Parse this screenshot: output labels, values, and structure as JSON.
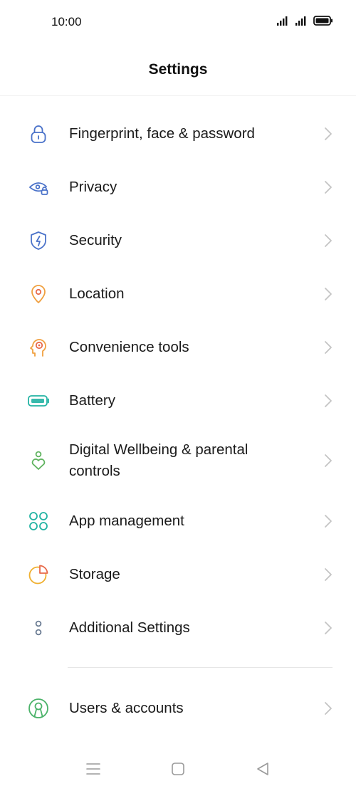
{
  "status_bar": {
    "time": "10:00",
    "icons": [
      "signal-icon",
      "signal-icon",
      "battery-icon"
    ]
  },
  "header": {
    "title": "Settings"
  },
  "settings": {
    "items": [
      {
        "label": "Fingerprint, face & password",
        "icon": "lock-icon",
        "color": "#4a72c9"
      },
      {
        "label": "Privacy",
        "icon": "privacy-eye-icon",
        "color": "#4a72c9"
      },
      {
        "label": "Security",
        "icon": "shield-icon",
        "color": "#4a72c9"
      },
      {
        "label": "Location",
        "icon": "location-pin-icon",
        "color": "#f0a040"
      },
      {
        "label": "Convenience tools",
        "icon": "convenience-tools-icon",
        "color": "#f0a040"
      },
      {
        "label": "Battery",
        "icon": "battery-icon",
        "color": "#22b3a3"
      },
      {
        "label": "Digital Wellbeing & parental controls",
        "icon": "wellbeing-icon",
        "color": "#5fb35f"
      },
      {
        "label": "App management",
        "icon": "app-grid-icon",
        "color": "#22b3a3"
      },
      {
        "label": "Storage",
        "icon": "storage-pie-icon",
        "color": "#f0b030"
      },
      {
        "label": "Additional Settings",
        "icon": "additional-settings-icon",
        "color": "#6b7c93"
      },
      {
        "label": "Users & accounts",
        "icon": "user-account-icon",
        "color": "#4cb36a"
      }
    ]
  },
  "nav_bar": {
    "icons": [
      "menu-icon",
      "home-icon",
      "back-icon"
    ]
  }
}
